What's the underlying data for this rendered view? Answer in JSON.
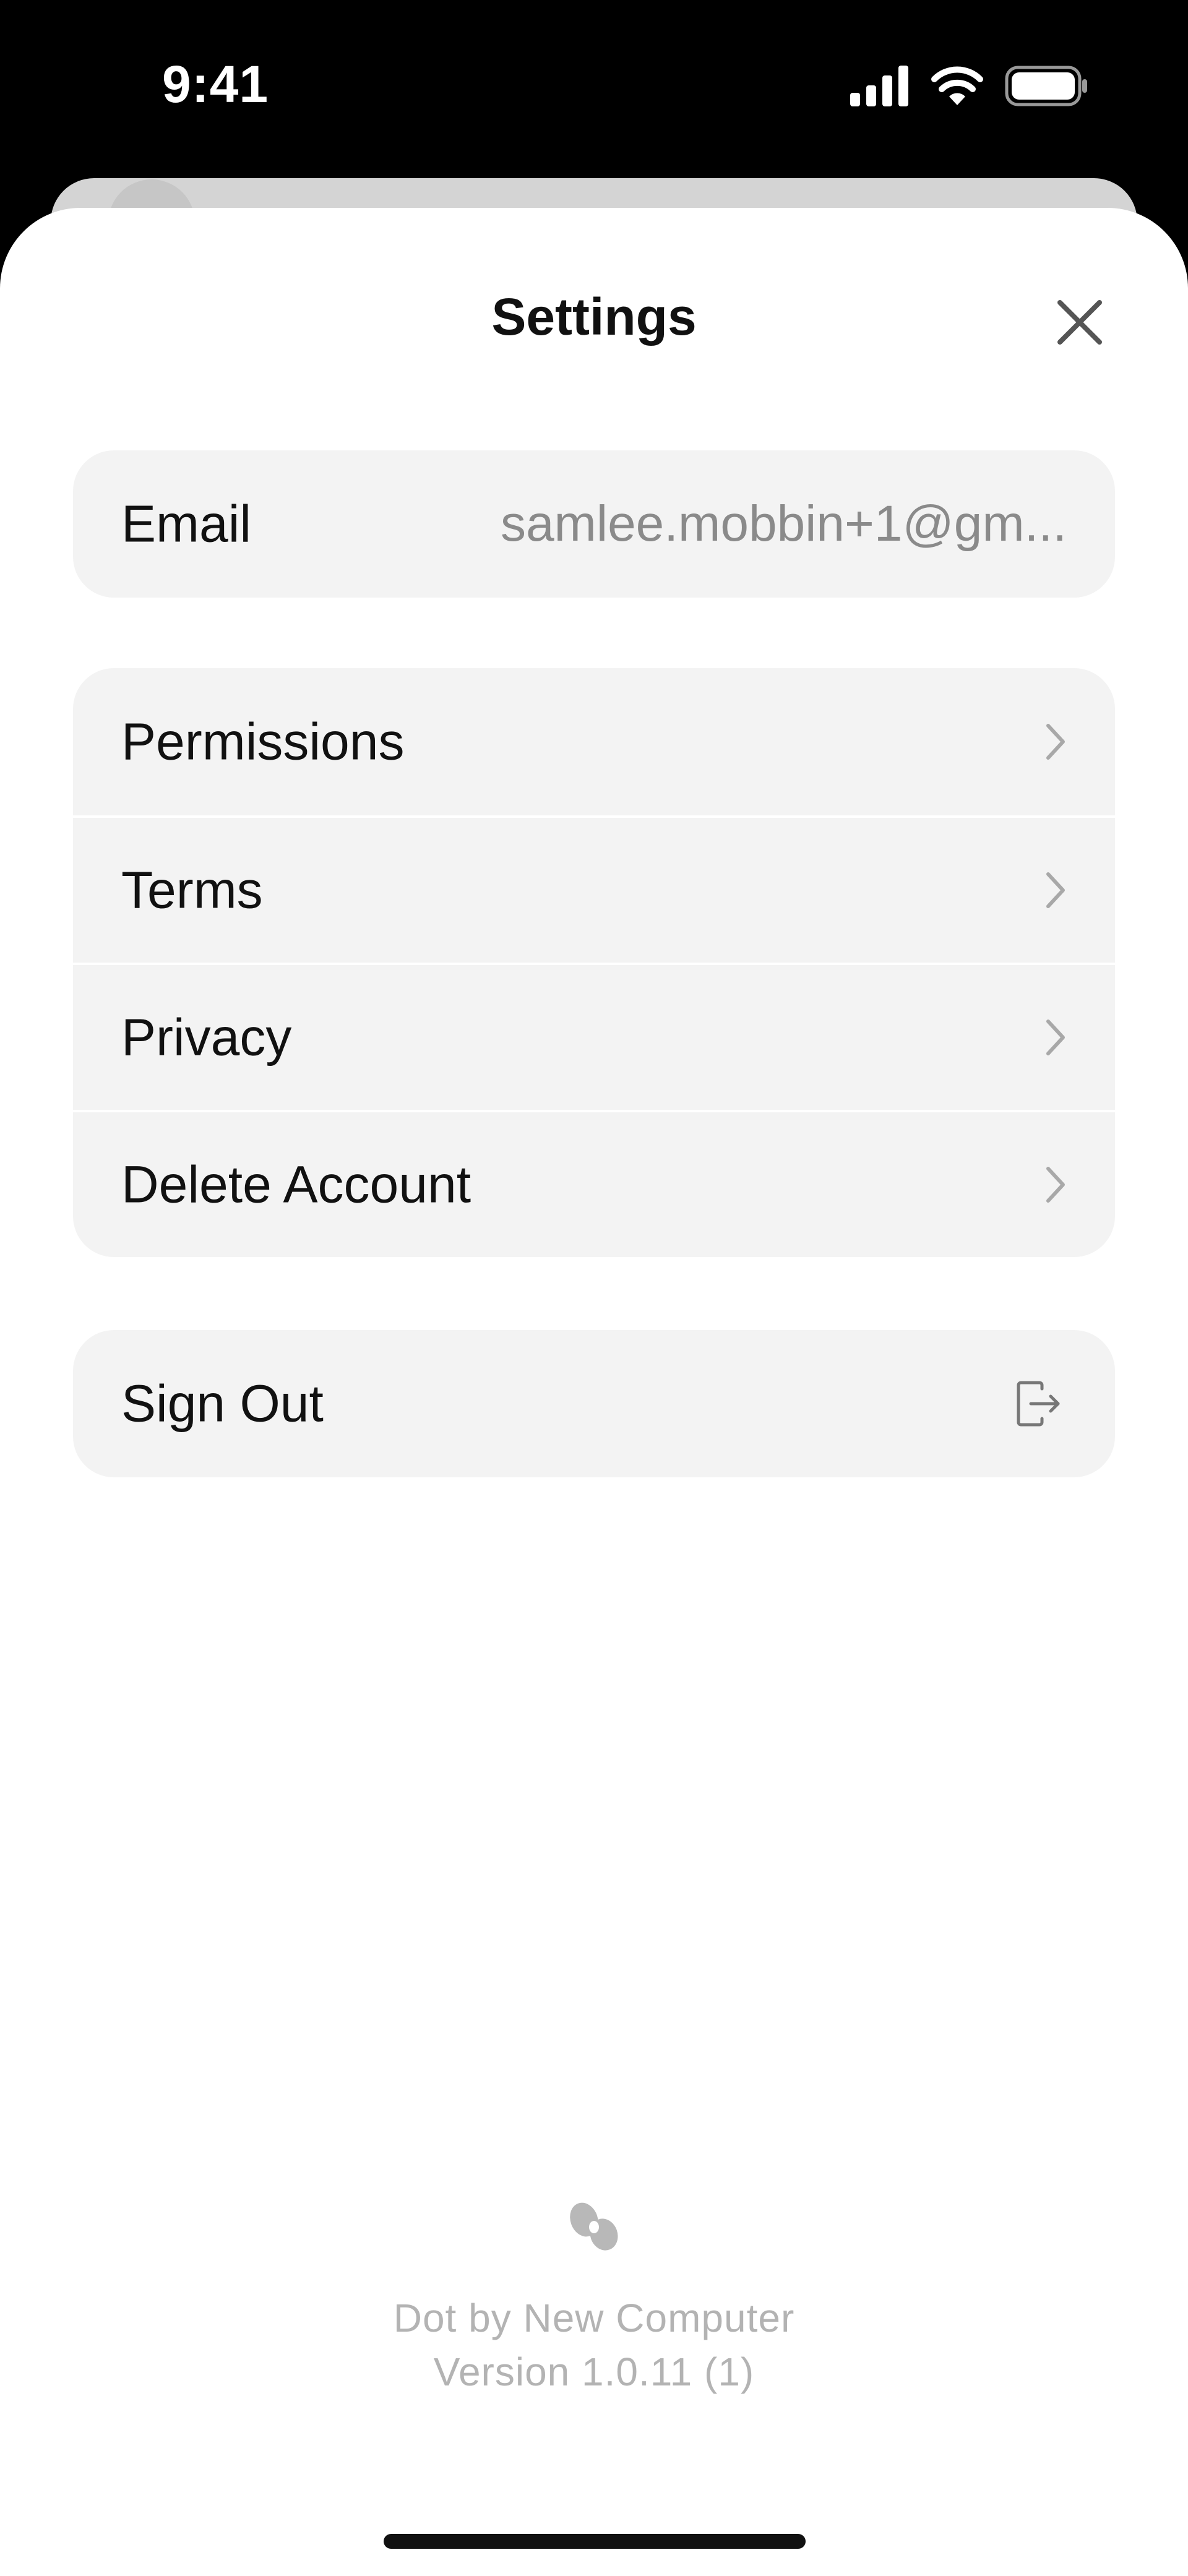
{
  "status_bar": {
    "time": "9:41",
    "icons": [
      "signal-icon",
      "wifi-icon",
      "battery-icon"
    ]
  },
  "sheet": {
    "title": "Settings",
    "close_icon": "close-icon"
  },
  "account": {
    "email_label": "Email",
    "email_value": "samlee.mobbin+1@gm..."
  },
  "menu": {
    "items": [
      {
        "label": "Permissions",
        "icon": "chevron-right-icon"
      },
      {
        "label": "Terms",
        "icon": "chevron-right-icon"
      },
      {
        "label": "Privacy",
        "icon": "chevron-right-icon"
      },
      {
        "label": "Delete Account",
        "icon": "chevron-right-icon"
      }
    ]
  },
  "sign_out": {
    "label": "Sign Out",
    "icon": "sign-out-icon"
  },
  "footer": {
    "logo_icon": "dot-logo-icon",
    "app_name": "Dot by New Computer",
    "version": "Version 1.0.11 (1)"
  },
  "colors": {
    "background": "#000000",
    "sheet": "#ffffff",
    "card": "#f3f3f3",
    "text_primary": "#111111",
    "text_secondary": "#8a8a8a",
    "footer_text": "#b3b3b3"
  }
}
